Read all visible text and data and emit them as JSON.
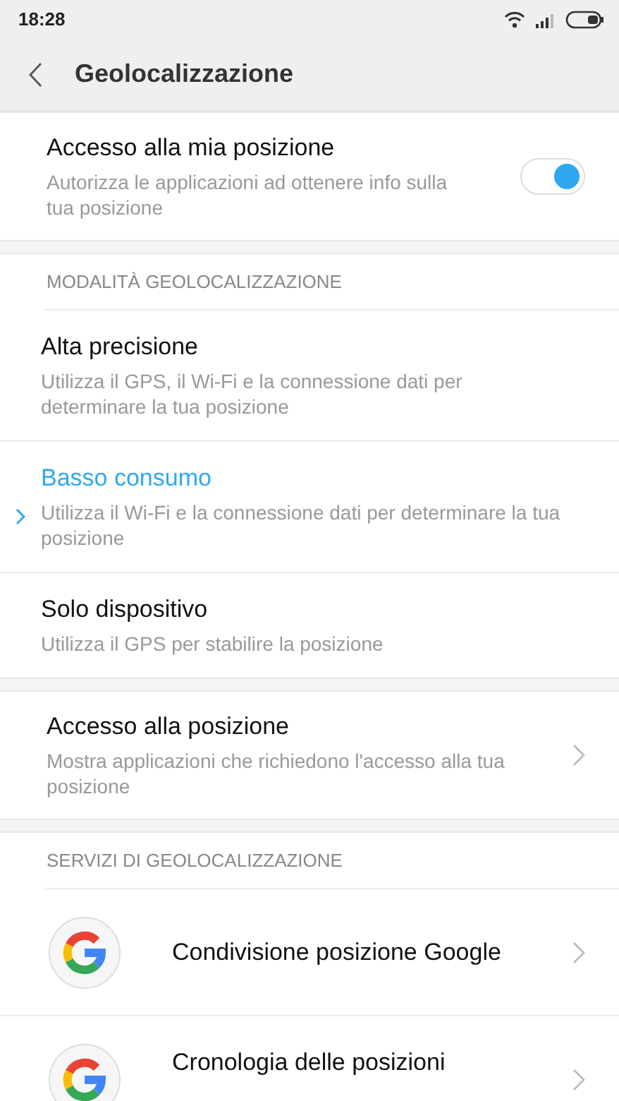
{
  "status_bar": {
    "time": "18:28"
  },
  "header": {
    "title": "Geolocalizzazione"
  },
  "location_access": {
    "title": "Accesso alla mia posizione",
    "subtitle": "Autorizza le applicazioni ad ottenere info sulla tua posizione",
    "on": true
  },
  "modes": {
    "heading": "MODALITÀ GEOLOCALIZZAZIONE",
    "items": [
      {
        "title": "Alta precisione",
        "description": "Utilizza il GPS, il Wi-Fi e la connessione dati per determinare la tua posizione",
        "selected": false
      },
      {
        "title": "Basso consumo",
        "description": "Utilizza il Wi-Fi e la connessione dati per determinare la tua posizione",
        "selected": true
      },
      {
        "title": "Solo dispositivo",
        "description": "Utilizza il GPS per stabilire la posizione",
        "selected": false
      }
    ]
  },
  "app_access": {
    "title": "Accesso alla posizione",
    "subtitle": "Mostra applicazioni che richiedono l'accesso alla tua posizione"
  },
  "services": {
    "heading": "SERVIZI DI GEOLOCALIZZAZIONE",
    "items": [
      {
        "label": "Condivisione posizione Google"
      },
      {
        "label": "Cronologia delle posizioni"
      }
    ]
  }
}
